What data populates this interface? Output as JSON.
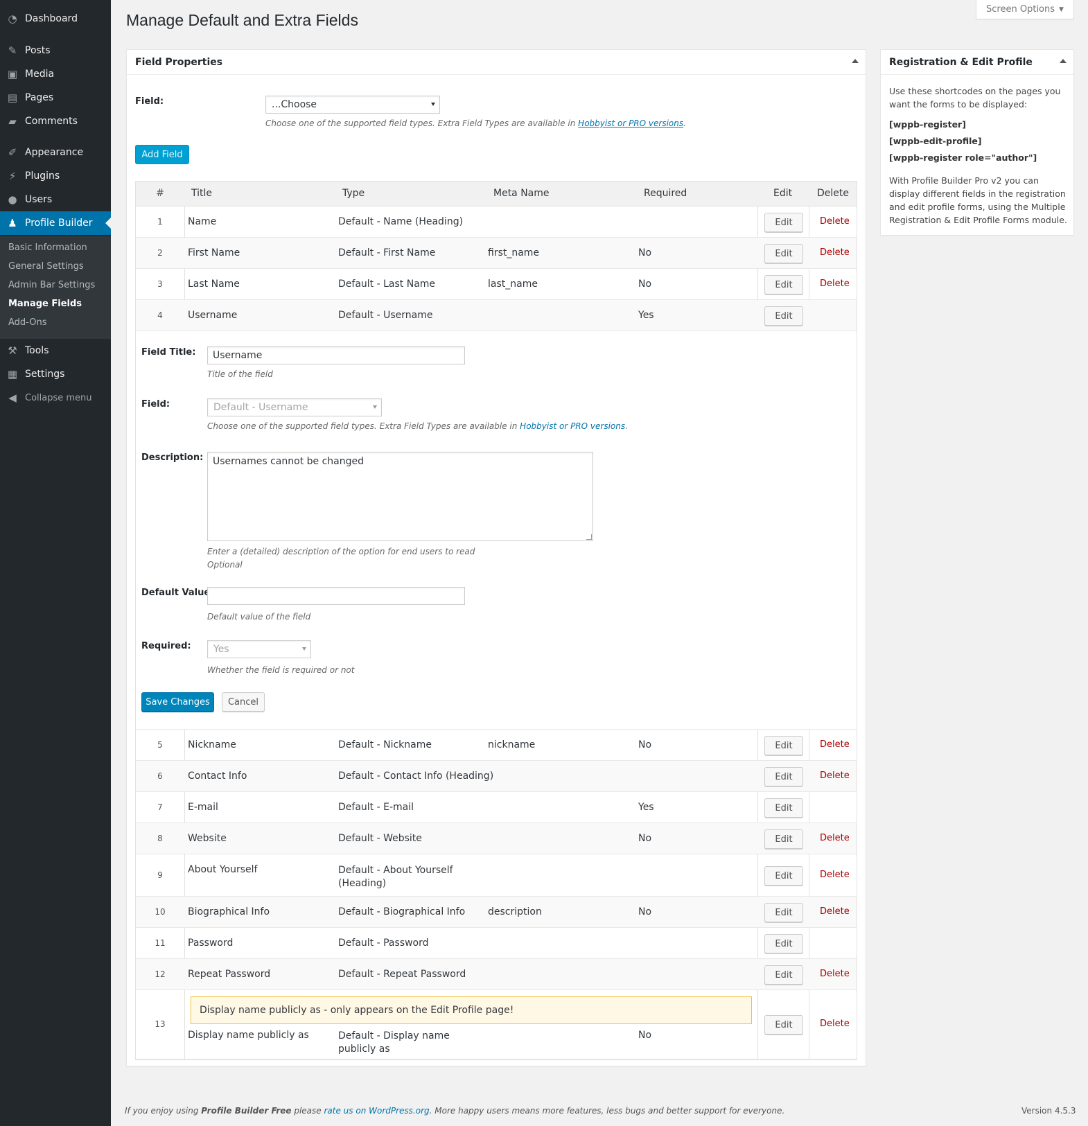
{
  "sidebar": {
    "items": [
      {
        "label": "Dashboard",
        "icon": "dashboard-icon"
      },
      {
        "label": "Posts",
        "icon": "pin-icon"
      },
      {
        "label": "Media",
        "icon": "media-icon"
      },
      {
        "label": "Pages",
        "icon": "page-icon"
      },
      {
        "label": "Comments",
        "icon": "comment-icon"
      },
      {
        "label": "Appearance",
        "icon": "brush-icon"
      },
      {
        "label": "Plugins",
        "icon": "plug-icon"
      },
      {
        "label": "Users",
        "icon": "user-icon"
      },
      {
        "label": "Profile Builder",
        "icon": "profile-icon"
      },
      {
        "label": "Tools",
        "icon": "wrench-icon"
      },
      {
        "label": "Settings",
        "icon": "settings-icon"
      },
      {
        "label": "Collapse menu",
        "icon": "collapse-icon"
      }
    ],
    "submenu": [
      "Basic Information",
      "General Settings",
      "Admin Bar Settings",
      "Manage Fields",
      "Add-Ons"
    ]
  },
  "screen_options": "Screen Options",
  "page_title": "Manage Default and Extra Fields",
  "field_properties": {
    "header": "Field Properties",
    "field_label": "Field:",
    "select_value": "...Choose",
    "hint_prefix": "Choose one of the supported field types. Extra Field Types are available in ",
    "hint_link": "Hobbyist or PRO versions",
    "hint_suffix": ".",
    "add_button": "Add Field"
  },
  "table": {
    "headers": {
      "num": "#",
      "title": "Title",
      "type": "Type",
      "meta": "Meta Name",
      "required": "Required",
      "edit": "Edit",
      "delete": "Delete"
    },
    "edit_label": "Edit",
    "delete_label": "Delete",
    "rows": [
      {
        "num": "1",
        "title": "Name",
        "type": "Default - Name (Heading)",
        "meta": "",
        "required": "",
        "delete": true
      },
      {
        "num": "2",
        "title": "First Name",
        "type": "Default - First Name",
        "meta": "first_name",
        "required": "No",
        "delete": true
      },
      {
        "num": "3",
        "title": "Last Name",
        "type": "Default - Last Name",
        "meta": "last_name",
        "required": "No",
        "delete": true
      },
      {
        "num": "4",
        "title": "Username",
        "type": "Default - Username",
        "meta": "",
        "required": "Yes",
        "delete": false
      },
      {
        "num": "5",
        "title": "Nickname",
        "type": "Default - Nickname",
        "meta": "nickname",
        "required": "No",
        "delete": true
      },
      {
        "num": "6",
        "title": "Contact Info",
        "type": "Default - Contact Info (Heading)",
        "meta": "",
        "required": "",
        "delete": true
      },
      {
        "num": "7",
        "title": "E-mail",
        "type": "Default - E-mail",
        "meta": "",
        "required": "Yes",
        "delete": false
      },
      {
        "num": "8",
        "title": "Website",
        "type": "Default - Website",
        "meta": "",
        "required": "No",
        "delete": true
      },
      {
        "num": "9",
        "title": "About Yourself",
        "type": "Default - About Yourself (Heading)",
        "meta": "",
        "required": "",
        "delete": true
      },
      {
        "num": "10",
        "title": "Biographical Info",
        "type": "Default - Biographical Info",
        "meta": "description",
        "required": "No",
        "delete": true
      },
      {
        "num": "11",
        "title": "Password",
        "type": "Default - Password",
        "meta": "",
        "required": "",
        "delete": false
      },
      {
        "num": "12",
        "title": "Repeat Password",
        "type": "Default - Repeat Password",
        "meta": "",
        "required": "",
        "delete": true
      },
      {
        "num": "13",
        "title": "Display name publicly as",
        "type": "Default - Display name publicly as",
        "meta": "",
        "required": "No",
        "delete": true,
        "notice": "Display name publicly as - only appears on the Edit Profile page!"
      }
    ]
  },
  "edit_form": {
    "field_title_label": "Field Title:",
    "field_title_value": "Username",
    "field_title_hint": "Title of the field",
    "field_label": "Field:",
    "field_value": "Default - Username",
    "field_hint_prefix": "Choose one of the supported field types. Extra Field Types are available in ",
    "field_hint_link": "Hobbyist or PRO versions",
    "field_hint_suffix": ".",
    "description_label": "Description:",
    "description_value": "Usernames cannot be changed",
    "description_hint": "Enter a (detailed) description of the option for end users to read",
    "description_hint2": "Optional",
    "default_value_label": "Default Value:",
    "default_value_value": "",
    "default_value_hint": "Default value of the field",
    "required_label": "Required:",
    "required_value": "Yes",
    "required_hint": "Whether the field is required or not",
    "save_button": "Save Changes",
    "cancel_button": "Cancel"
  },
  "registration_box": {
    "header": "Registration & Edit Profile",
    "intro": "Use these shortcodes on the pages you want the forms to be displayed:",
    "shortcodes": [
      "[wppb-register]",
      "[wppb-edit-profile]",
      "[wppb-register role=\"author\"]"
    ],
    "pro_text": "With Profile Builder Pro v2 you can display different fields in the registration and edit profile forms, using the Multiple Registration & Edit Profile Forms module."
  },
  "footer": {
    "prefix": "If you enjoy using ",
    "product": "Profile Builder Free",
    "middle": " please ",
    "link": "rate us on WordPress.org",
    "suffix": ". More happy users means more features, less bugs and better support for everyone.",
    "version": "Version 4.5.3"
  }
}
